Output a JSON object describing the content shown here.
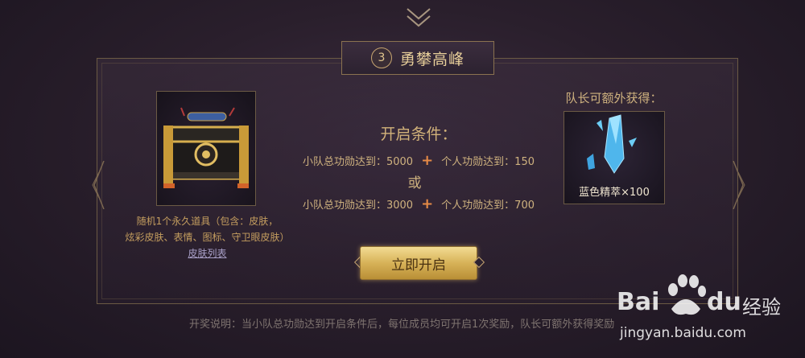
{
  "stage": {
    "number": "3",
    "title": "勇攀高峰"
  },
  "reward": {
    "caption_line1": "随机1个永久道具（包含：皮肤，",
    "caption_line2": "炫彩皮肤、表情、图标、守卫眼皮肤）",
    "skin_link": "皮肤列表"
  },
  "conditions": {
    "title": "开启条件：",
    "option1": {
      "team": "小队总功勋达到：5000",
      "plus": "+",
      "personal": "个人功勋达到：150"
    },
    "or": "或",
    "option2": {
      "team": "小队总功勋达到：3000",
      "plus": "+",
      "personal": "个人功勋达到：700"
    }
  },
  "open_button": "立即开启",
  "leader": {
    "title": "队长可额外获得：",
    "item": "蓝色精萃×100"
  },
  "footer_note": "开奖说明：当小队总功勋达到开启条件后，每位成员均可开启1次奖励，队长可额外获得奖励",
  "watermark": {
    "brand_left": "Bai",
    "brand_right": "du",
    "brand_cn": "经验",
    "url": "jingyan.baidu.com"
  },
  "colors": {
    "gold": "#c8a86a",
    "button_gold": "#d7b258",
    "accent_plus": "#e58a46",
    "crystal_blue": "#5ecbf0"
  },
  "icons": [
    "chevron-down-icon",
    "treasure-chest-icon",
    "blue-crystal-icon",
    "baidu-paw-icon"
  ]
}
